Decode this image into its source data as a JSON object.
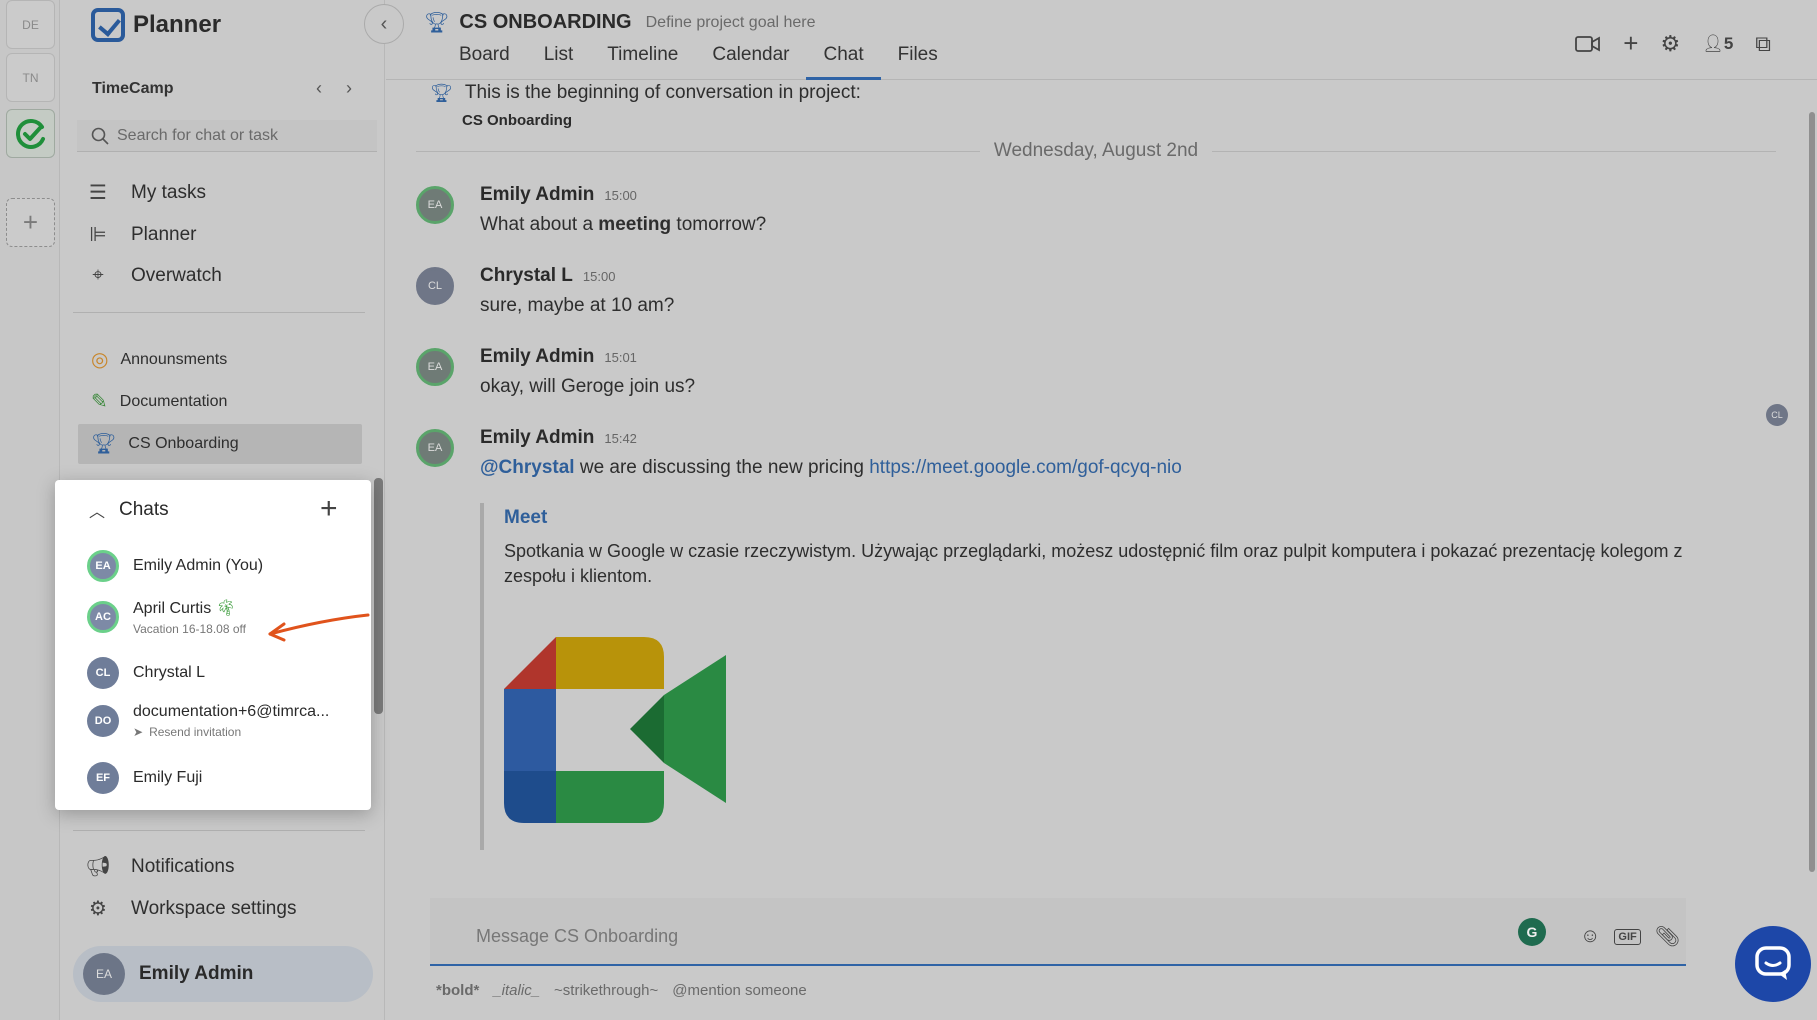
{
  "rail": {
    "items": [
      {
        "label": "DE"
      },
      {
        "label": "TN"
      }
    ],
    "add_label": "+"
  },
  "app": {
    "name": "Planner",
    "collapse_icon": "chevron-left-icon"
  },
  "workspace": {
    "name": "TimeCamp"
  },
  "search": {
    "placeholder": "Search for chat or task"
  },
  "nav": {
    "items": [
      {
        "label": "My tasks",
        "icon": "task-list-icon"
      },
      {
        "label": "Planner",
        "icon": "gantt-icon"
      },
      {
        "label": "Overwatch",
        "icon": "telescope-icon"
      }
    ]
  },
  "projects": {
    "items": [
      {
        "label": "Announsments",
        "icon": "target-icon"
      },
      {
        "label": "Documentation",
        "icon": "brush-icon"
      },
      {
        "label": "CS Onboarding",
        "icon": "trophy-icon"
      }
    ]
  },
  "chats_popup": {
    "title": "Chats",
    "items": [
      {
        "initials": "EA",
        "name": "Emily Admin (You)",
        "sub": ""
      },
      {
        "initials": "AC",
        "name": "April Curtis",
        "sub": "Vacation 16-18.08 off"
      },
      {
        "initials": "CL",
        "name": "Chrystal L",
        "sub": ""
      },
      {
        "initials": "DO",
        "name": "documentation+6@timrca...",
        "sub": "Resend invitation"
      },
      {
        "initials": "EF",
        "name": "Emily Fuji",
        "sub": ""
      }
    ]
  },
  "bottom": {
    "notifications": "Notifications",
    "settings": "Workspace settings",
    "user_initials": "EA",
    "user_name": "Emily Admin"
  },
  "project": {
    "title": "CS ONBOARDING",
    "goal_placeholder": "Define project goal here",
    "tabs": [
      "Board",
      "List",
      "Timeline",
      "Calendar",
      "Chat",
      "Files"
    ],
    "active_tab": "Chat",
    "members_count": "5"
  },
  "conversation": {
    "start_text": "This is the beginning of conversation in project:",
    "project_name": "CS Onboarding",
    "date": "Wednesday, August 2nd",
    "messages": [
      {
        "initials": "EA",
        "author": "Emily Admin",
        "time": "15:00",
        "pre": "What about a ",
        "bold": "meeting",
        "post": " tomorrow?"
      },
      {
        "initials": "CL",
        "author": "Chrystal L",
        "time": "15:00",
        "text": "sure, maybe at 10 am?"
      },
      {
        "initials": "EA",
        "author": "Emily Admin",
        "time": "15:01",
        "text": "okay, will Geroge join us?"
      },
      {
        "initials": "EA",
        "author": "Emily Admin",
        "time": "15:42",
        "mention": "@Chrystal",
        "mid": " we are discussing the new pricing ",
        "link": "https://meet.google.com/gof-qcyq-nio"
      }
    ],
    "preview": {
      "title": "Meet",
      "description": "Spotkania w Google w czasie rzeczywistym. Używając przeglądarki, możesz udostępnić film oraz pulpit komputera i pokazać prezentację kolegom z zespołu i klientom."
    },
    "reader_initials": "CL"
  },
  "composer": {
    "placeholder": "Message CS Onboarding",
    "hint_bold": "*bold*",
    "hint_italic": "_italic_",
    "hint_strike": "~strikethrough~",
    "hint_mention": "@mention someone"
  },
  "colors": {
    "accent": "#2f63a6",
    "link": "#2f5f9a",
    "fab": "#1d47a8",
    "online": "#6bd08a"
  }
}
